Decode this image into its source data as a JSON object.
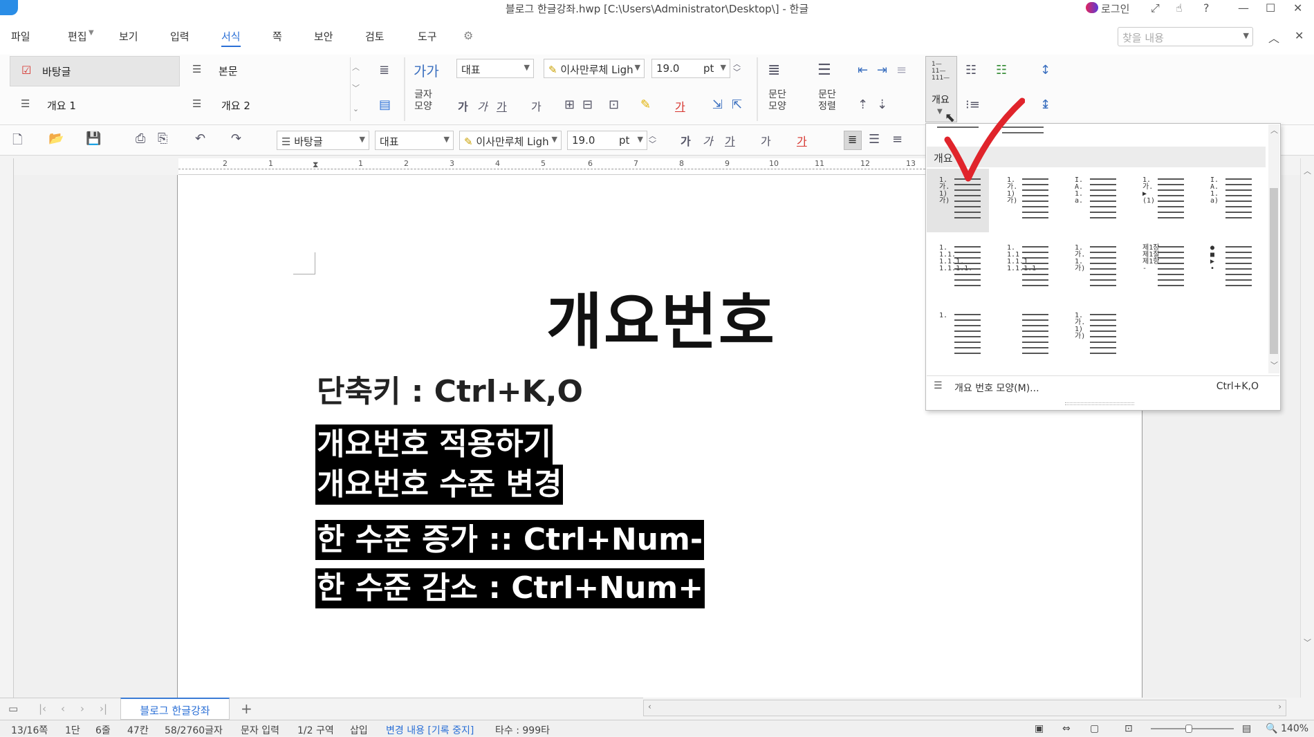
{
  "window": {
    "title": "블로그 한글강좌.hwp [C:\\Users\\Administrator\\Desktop\\] - 한글",
    "login": "로그인"
  },
  "menubar": {
    "items": [
      "파일",
      "편집",
      "보기",
      "입력",
      "서식",
      "쪽",
      "보안",
      "검토",
      "도구"
    ],
    "active": "서식",
    "search_placeholder": "찾을 내용"
  },
  "ribbon": {
    "styles": [
      {
        "label": "바탕글"
      },
      {
        "label": "본문"
      },
      {
        "label": "개요 1"
      },
      {
        "label": "개요 2"
      }
    ],
    "char_shape_label": [
      "글자",
      "모양"
    ],
    "char_sample": "가가",
    "font_category": "대표",
    "font_name": "이사만루체 Ligh",
    "font_size": "19.0",
    "font_unit": "pt",
    "format_glyphs": [
      "가",
      "가",
      "가",
      "가",
      "가",
      "가"
    ],
    "para_shape_label": [
      "문단",
      "모양"
    ],
    "para_align_label": [
      "문단",
      "정렬"
    ],
    "outline_label": "개요"
  },
  "toolbar": {
    "style": "바탕글",
    "font_category": "대표",
    "font_name": "이사만루체 Ligh",
    "font_size": "19.0",
    "font_unit": "pt",
    "format_glyphs": [
      "가",
      "가",
      "가",
      "가",
      "가"
    ]
  },
  "ruler": {
    "ticks": [
      "2",
      "1",
      "1",
      "2",
      "3",
      "4",
      "5",
      "6",
      "7",
      "8",
      "9",
      "10",
      "11",
      "12",
      "13"
    ]
  },
  "document": {
    "title": "개요번호",
    "lines": [
      {
        "text": "단축키 : Ctrl+K,O",
        "selected": false
      },
      {
        "text": "개요번호 적용하기",
        "selected": true
      },
      {
        "text": "개요번호 수준 변경",
        "selected": true
      },
      {
        "text": "한 수준 증가 :: Ctrl+Num-",
        "selected": true
      },
      {
        "text": "한 수준 감소 : Ctrl+Num+",
        "selected": true
      }
    ]
  },
  "outline_dropdown": {
    "header": "개요",
    "styles": [
      {
        "glyph": "1.\n가.\n1)\n가)",
        "selected": true
      },
      {
        "glyph": "1.\n가.\n1)\n가)",
        "selected": false
      },
      {
        "glyph": "I.\nA.\n1.\na.",
        "selected": false
      },
      {
        "glyph": "1.\n가.\n▶\n(1)",
        "selected": false
      },
      {
        "glyph": "I.\nA.\n1.\na)",
        "selected": false
      },
      {
        "glyph": "1.\n1.1.\n1.1.1.\n1.1.1.1.",
        "selected": false
      },
      {
        "glyph": "1.\n1.1\n1.1.1\n1.1.1.1",
        "selected": false
      },
      {
        "glyph": "1.\n가.\n1.\n가)",
        "selected": false
      },
      {
        "glyph": "제1장\n제1절\n제1항\n-",
        "selected": false
      },
      {
        "glyph": "●\n■\n▶\n•",
        "selected": false
      },
      {
        "glyph": "1.",
        "selected": false
      },
      {
        "glyph": "",
        "selected": false
      },
      {
        "glyph": "1.\n가.\n1)\n가)",
        "selected": false
      }
    ],
    "footer_label": "개요 번호 모양(M)...",
    "footer_shortcut": "Ctrl+K,O"
  },
  "tabs": {
    "doc_tab": "블로그 한글강좌",
    "add": "+"
  },
  "statusbar": {
    "page": "13/16쪽",
    "column": "1단",
    "line": "6줄",
    "col": "47칸",
    "chars": "58/2760글자",
    "input_mode": "문자 입력",
    "section": "1/2 구역",
    "insert": "삽입",
    "track": "변경 내용 [기록 중지]",
    "taskcount": "타수 : 999타",
    "zoom": "140%"
  },
  "colors": {
    "accent": "#2a6fd6",
    "selection_bg": "#000000",
    "check_red": "#e0242b"
  }
}
